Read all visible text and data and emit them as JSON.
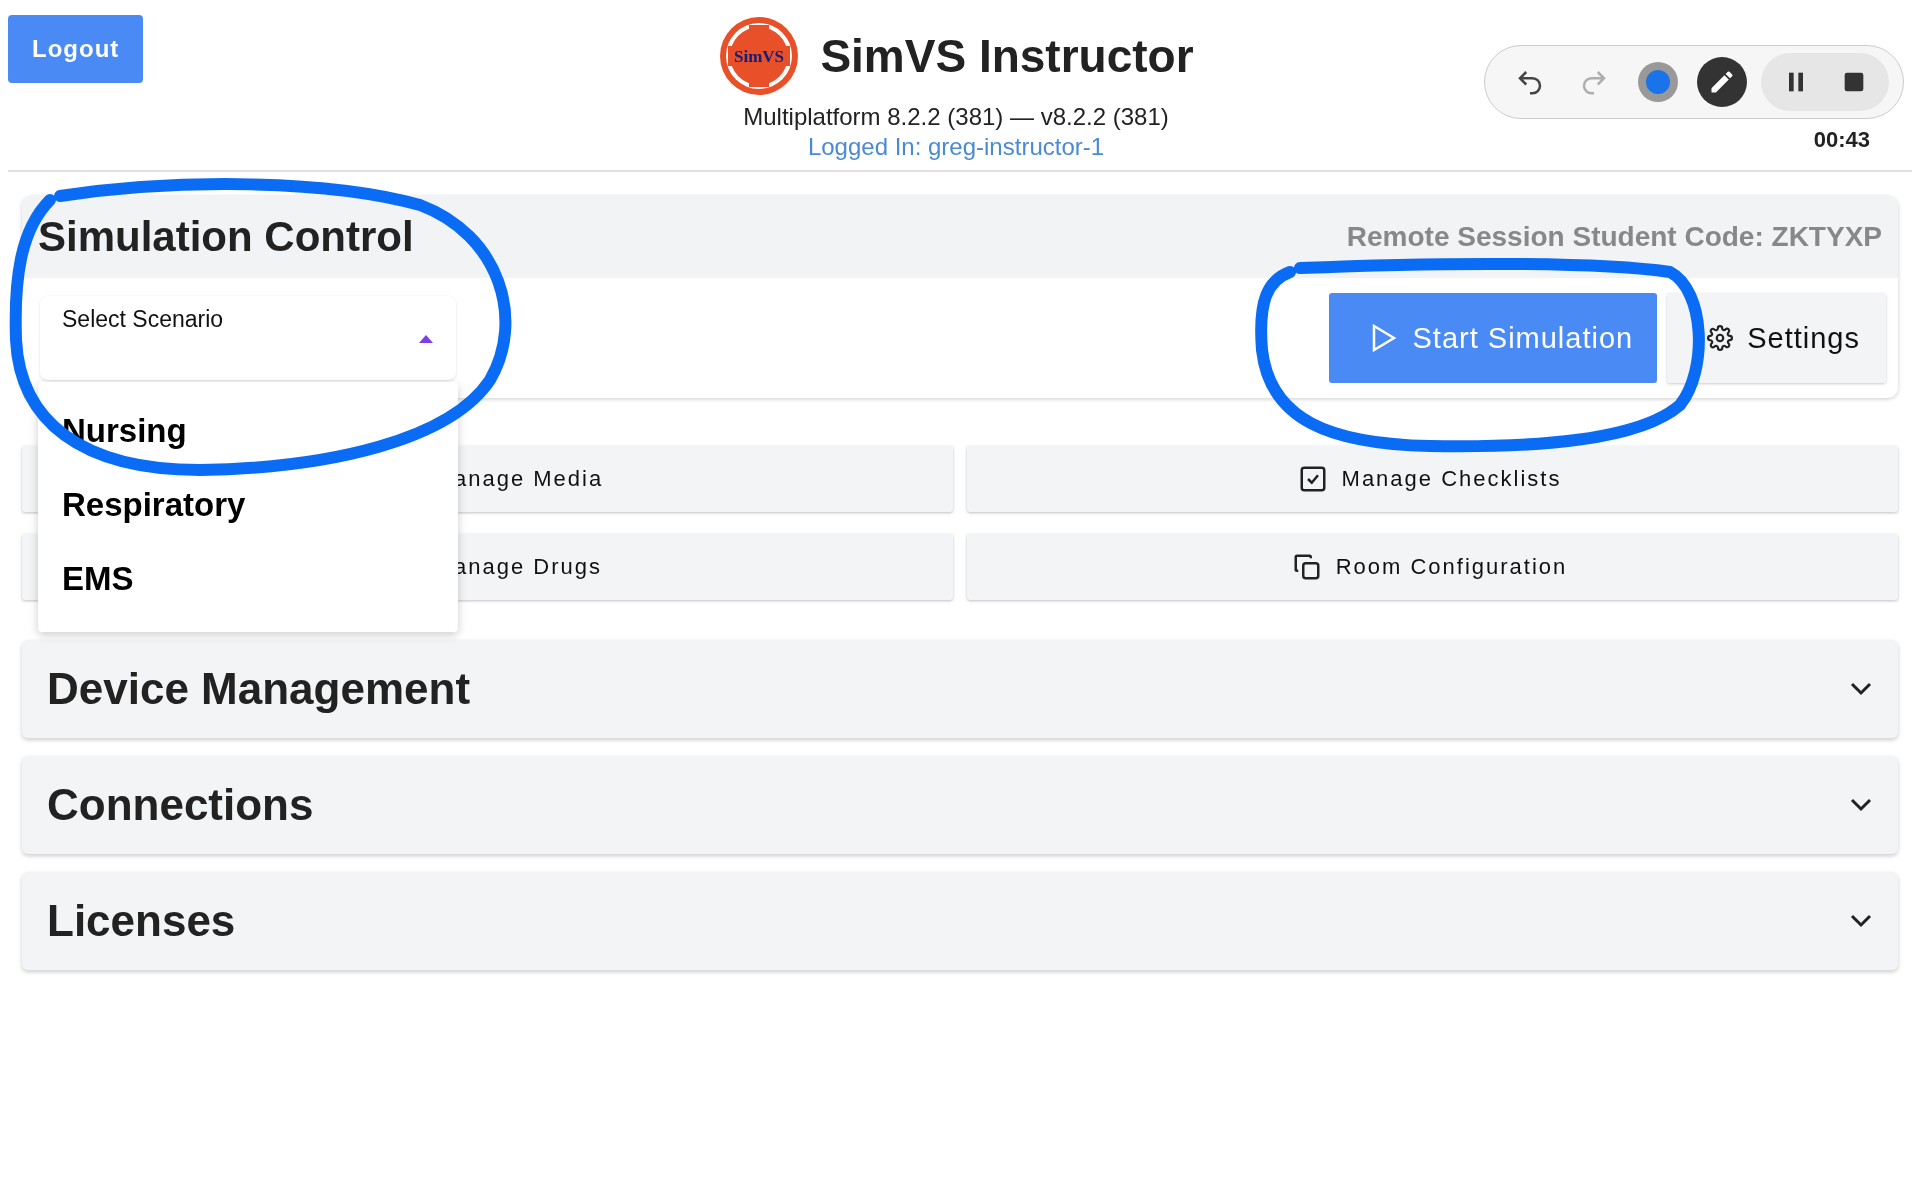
{
  "header": {
    "logout": "Logout",
    "logo_text": "SimVS",
    "title": "SimVS Instructor",
    "version": "Multiplatform 8.2.2 (381) — v8.2.2 (381)",
    "logged_in": "Logged In: greg-instructor-1"
  },
  "toolbar": {
    "tools": [
      {
        "kind": "undo",
        "selected": false,
        "disabled": false
      },
      {
        "kind": "redo",
        "selected": false,
        "disabled": true
      },
      {
        "kind": "color",
        "selected": false,
        "disabled": false
      },
      {
        "kind": "pen",
        "selected": true,
        "disabled": false
      }
    ],
    "playback": [
      {
        "kind": "pause"
      },
      {
        "kind": "stop"
      }
    ],
    "timer": "00:43"
  },
  "simulation_control": {
    "title": "Simulation Control",
    "remote_code": "Remote Session Student Code: ZKTYXP",
    "select": {
      "label": "Select Scenario",
      "expanded": true,
      "options": [
        "Nursing",
        "Respiratory",
        "EMS"
      ]
    },
    "start_button": "Start Simulation",
    "settings_button": "Settings"
  },
  "actions": [
    {
      "kind": "hidden",
      "label": "anage Media"
    },
    {
      "kind": "checklist",
      "label": "Manage Checklists"
    },
    {
      "kind": "hidden",
      "label": "anage Drugs"
    },
    {
      "kind": "rooms",
      "label": "Room Configuration"
    }
  ],
  "sections": [
    {
      "title": "Device Management",
      "expanded": false
    },
    {
      "title": "Connections",
      "expanded": false
    },
    {
      "title": "Licenses",
      "expanded": false
    }
  ]
}
